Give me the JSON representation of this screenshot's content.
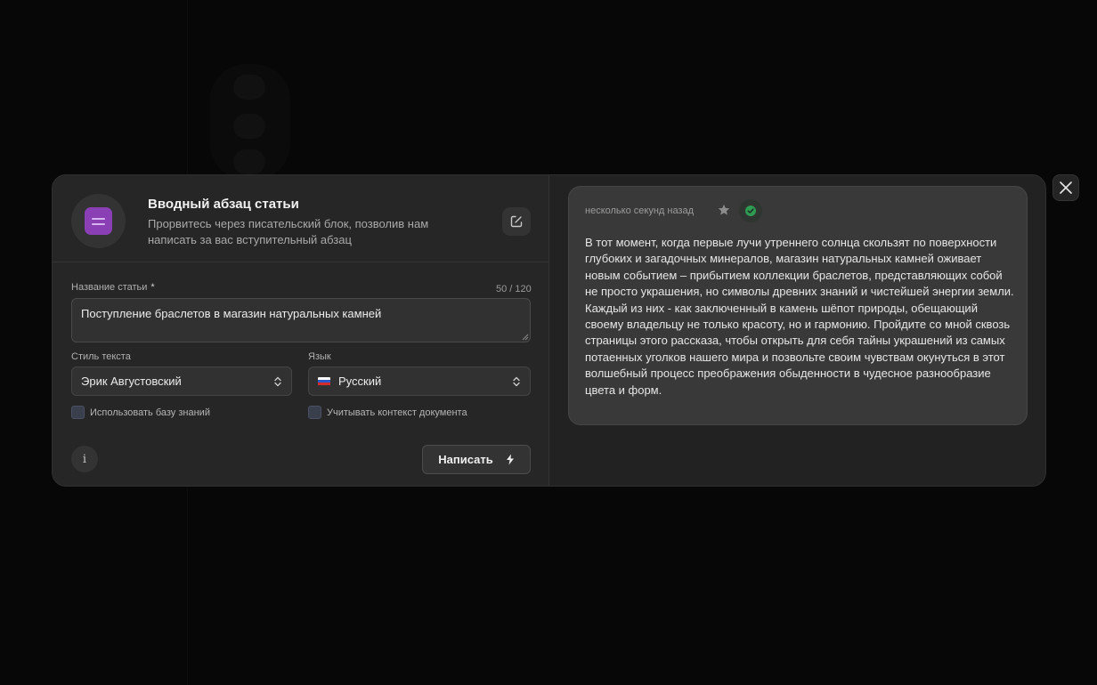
{
  "modal": {
    "title": "Вводный абзац статьи",
    "subtitle": "Прорвитесь через писательский блок, позволив нам написать за вас вступительный абзац"
  },
  "form": {
    "title_label": "Название статьи",
    "title_required_mark": "*",
    "title_counter": "50 / 120",
    "title_value": "Поступление браслетов в магазин натуральных камней",
    "style_label": "Стиль текста",
    "style_value": "Эрик Августовский",
    "language_label": "Язык",
    "language_value": "Русский",
    "knowledge_base_label": "Использовать базу знаний",
    "knowledge_base_checked": false,
    "doc_context_label": "Учитывать контекст документа",
    "doc_context_checked": false,
    "info_label": "i",
    "write_button_label": "Написать"
  },
  "result": {
    "timestamp": "несколько секунд назад",
    "text": "В тот момент, когда первые лучи утреннего солнца скользят по поверхности глубоких и загадочных минералов, магазин натуральных камней оживает новым событием – прибытием коллекции браслетов, представляющих собой не просто украшения, но символы древних знаний и чистейшей энергии земли. Каждый из них - как заключенный в камень шёпот природы, обещающий своему владельцу не только красоту, но и гармонию. Пройдите со мной сквозь страницы этого рассказа, чтобы открыть для себя тайны украшений из самых потаенных уголков нашего мира и позвольте своим чувствам окунуться в этот волшебный процесс преображения обыденности в чудесное разнообразие цвета и форм."
  },
  "icons": {
    "app": "document-text-icon",
    "header_action": "external-link-icon",
    "close": "close-icon",
    "star": "star-icon",
    "approve": "check-circle-icon",
    "write": "lightning-icon",
    "select": "chevron-up-down-icon",
    "flag": "russia-flag-icon"
  },
  "colors": {
    "modal_bg": "#262626",
    "accent_purple": "#8a3fb5",
    "approve_green": "#2e9a52"
  }
}
